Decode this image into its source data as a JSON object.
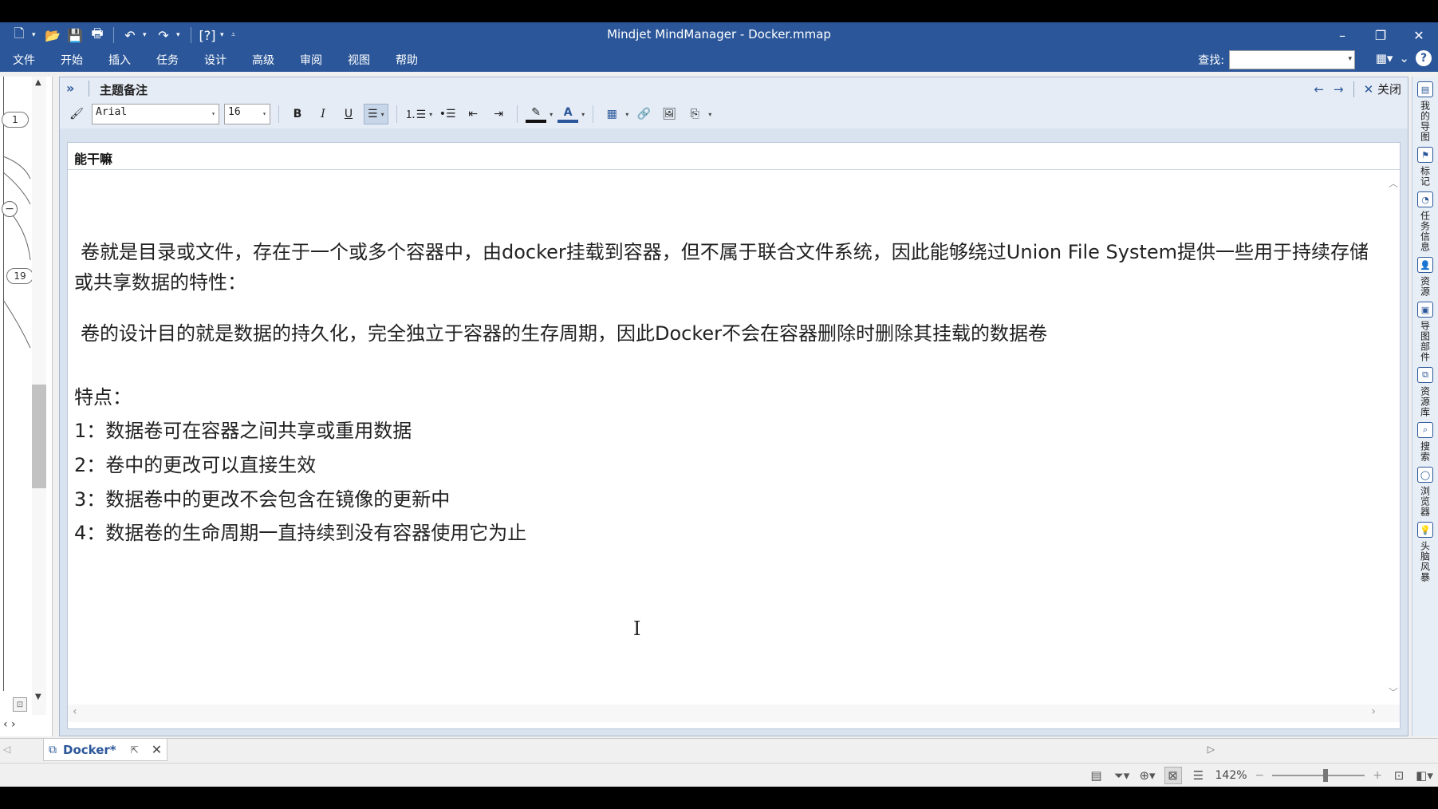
{
  "app": {
    "title": "Mindjet MindManager - Docker.mmap"
  },
  "menubar": {
    "items": [
      "文件",
      "开始",
      "插入",
      "任务",
      "设计",
      "高级",
      "审阅",
      "视图",
      "帮助"
    ],
    "find_label": "查找:",
    "find_value": ""
  },
  "leftpanel": {
    "badge_top": "1",
    "badge_bottom": "19",
    "collapse_symbol": "−"
  },
  "notes": {
    "pane_title": "主题备注",
    "close_label": "关闭",
    "font_name": "Arial",
    "font_size": "16",
    "topic_title": "能干嘛",
    "paragraphs": [
      "卷就是目录或文件，存在于一个或多个容器中，由docker挂载到容器，但不属于联合文件系统，因此能够绕过Union File System提供一些用于持续存储或共享数据的特性：",
      "卷的设计目的就是数据的持久化，完全独立于容器的生存周期，因此Docker不会在容器删除时删除其挂载的数据卷",
      "特点：",
      "1：数据卷可在容器之间共享或重用数据",
      "2：卷中的更改可以直接生效",
      "3：数据卷中的更改不会包含在镜像的更新中",
      "4：数据卷的生命周期一直持续到没有容器使用它为止"
    ]
  },
  "rightdock": {
    "items": [
      "我的导图",
      "标记",
      "任务信息",
      "资源",
      "导图部件",
      "资源库",
      "搜索",
      "浏览器",
      "头脑风暴"
    ]
  },
  "tabs": {
    "doc_tab": "Docker*"
  },
  "status": {
    "zoom": "142%"
  },
  "colors": {
    "titlebar": "#2b579a",
    "accent": "#2b579a"
  }
}
